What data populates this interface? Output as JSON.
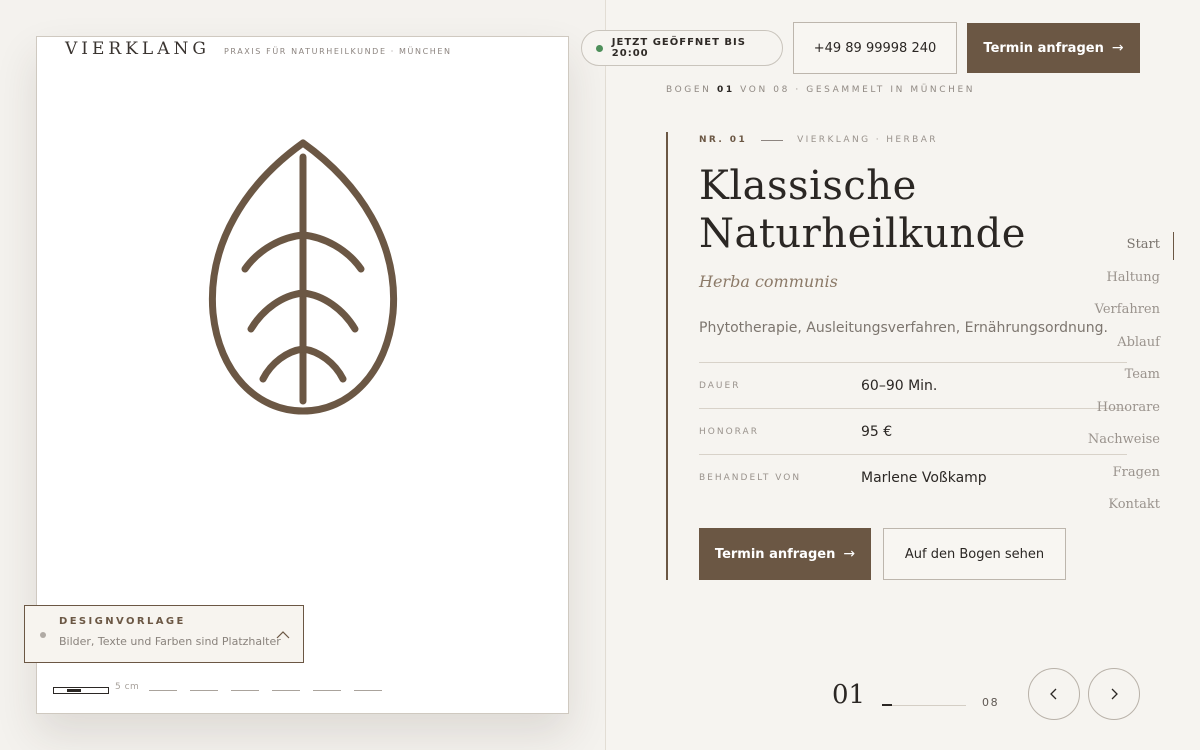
{
  "brand": {
    "name": "VIERKLANG",
    "tagline": "PRAXIS FÜR NATURHEILKUNDE · MÜNCHEN"
  },
  "status": {
    "text": "JETZT GEÖFFNET BIS 20:00",
    "color": "#4e8f5a"
  },
  "header": {
    "phone": "+49 89 99998 240",
    "cta_label": "Termin anfragen",
    "cta_arrow": "→"
  },
  "counter": {
    "prefix": "BOGEN",
    "current": "01",
    "middle": "VON 08 · GESAMMELT IN MÜNCHEN"
  },
  "card": {
    "nr": "NR. 01",
    "source": "VIERKLANG · HERBAR",
    "title_line1": "Klassische",
    "title_line2": "Naturheilkunde",
    "latin": "Herba communis",
    "description": "Phytotherapie, Ausleitungsverfahren, Ernährungsordnung.",
    "facts": [
      {
        "label": "DAUER",
        "value": "60–90 Min."
      },
      {
        "label": "HONORAR",
        "value": "95 €"
      },
      {
        "label": "BEHANDELT VON",
        "value": "Marlene Voßkamp"
      }
    ],
    "primary_label": "Termin anfragen",
    "primary_arrow": "→",
    "secondary_label": "Auf den Bogen sehen"
  },
  "sidenav": [
    "Start",
    "Haltung",
    "Verfahren",
    "Ablauf",
    "Team",
    "Honorare",
    "Nachweise",
    "Fragen",
    "Kontakt"
  ],
  "design_notice": {
    "title": "DESIGNVORLAGE",
    "subtitle": "Bilder, Texte und Farben sind Platzhalter"
  },
  "scale": {
    "label": "5 cm"
  },
  "pager": {
    "current": "01",
    "total": "08",
    "prev_icon": "chevron-left-icon",
    "next_icon": "chevron-right-icon"
  },
  "colors": {
    "accent": "#6b5744",
    "background": "#f6f4f0",
    "sheet": "#ffffff"
  }
}
